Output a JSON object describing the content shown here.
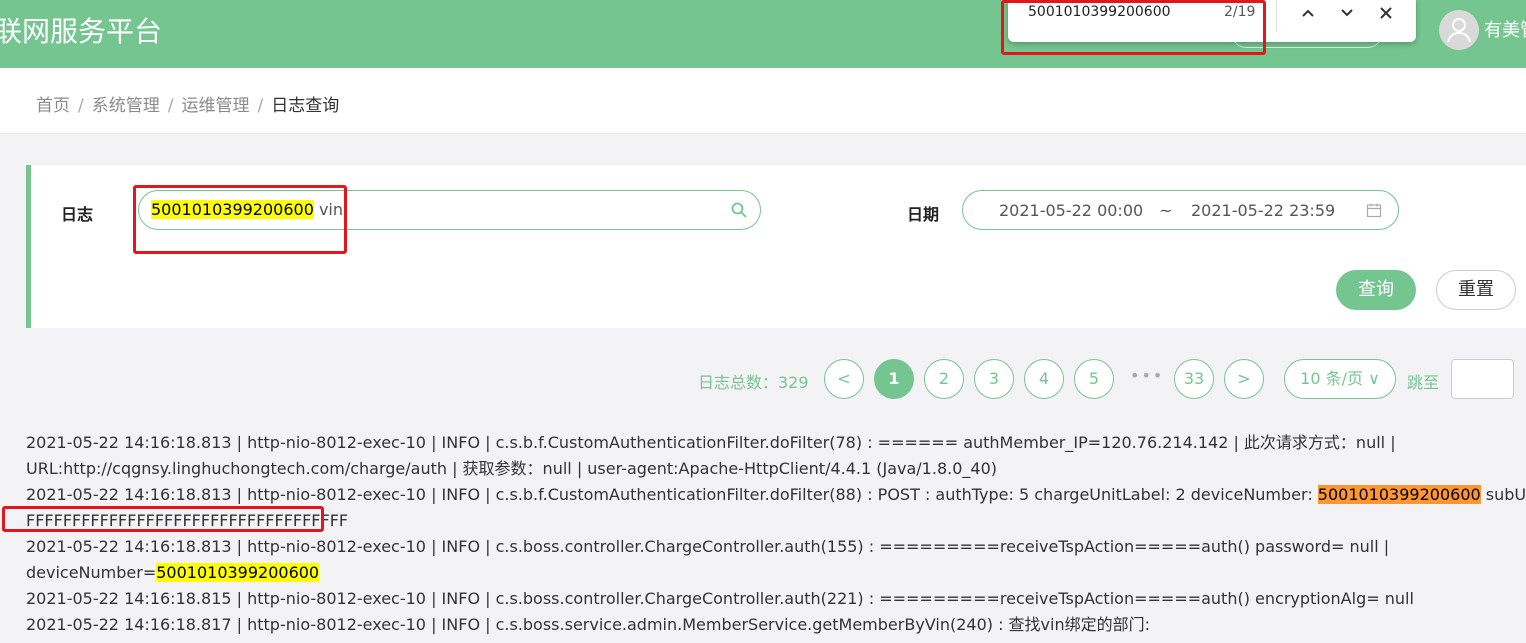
{
  "header": {
    "title": "联网服务平台",
    "user_name": "有美管",
    "avatar_icon": "user-avatar-icon"
  },
  "find_bar": {
    "query": "5001010399200600",
    "count": "2/19",
    "prev_icon": "chevron-up-icon",
    "next_icon": "chevron-down-icon",
    "close_icon": "close-icon"
  },
  "breadcrumb": {
    "items": [
      "首页",
      "系统管理",
      "运维管理"
    ],
    "current": "日志查询"
  },
  "filter": {
    "log_label": "日志",
    "log_value_highlight": "5001010399200600",
    "log_value_rest": " vin",
    "date_label": "日期",
    "date_start": "2021-05-22 00:00",
    "date_sep": "~",
    "date_end": "2021-05-22 23:59",
    "query_button": "查询",
    "reset_button": "重置"
  },
  "pagination": {
    "total": "日志总数：329",
    "prev": "<",
    "pages": [
      "1",
      "2",
      "3",
      "4",
      "5"
    ],
    "active_page": "1",
    "ellipsis": "•••",
    "last_page": "33",
    "next": ">",
    "page_size": "10 条/页",
    "jump_label": "跳至"
  },
  "logs": [
    {
      "pre": "2021-05-22 14:16:18.813 | http-nio-8012-exec-10 | INFO | c.s.b.f.CustomAuthenticationFilter.doFilter(78) : ====== authMember_IP=120.76.214.142 | 此次请求方式：null |",
      "hl": "",
      "post": ""
    },
    {
      "pre": "URL:http://cqgnsy.linghuchongtech.com/charge/auth | 获取参数：null | user-agent:Apache-HttpClient/4.4.1 (Java/1.8.0_40)",
      "hl": "",
      "post": ""
    },
    {
      "pre": "2021-05-22 14:16:18.813 | http-nio-8012-exec-10 | INFO | c.s.b.f.CustomAuthenticationFilter.doFilter(88) : POST : authType: 5 chargeUnitLabel: 2 deviceNumber: ",
      "hl": "5001010399200600",
      "post": " subUnits: vin:",
      "current": true
    },
    {
      "pre": "FFFFFFFFFFFFFFFFFFFFFFFFFFFFFFFFFFF",
      "hl": "",
      "post": ""
    },
    {
      "pre": "2021-05-22 14:16:18.813 | http-nio-8012-exec-10 | INFO | c.s.boss.controller.ChargeController.auth(155) : =========receiveTspAction=====auth() password= null |",
      "hl": "",
      "post": ""
    },
    {
      "pre": "deviceNumber=",
      "hl": "5001010399200600",
      "post": ""
    },
    {
      "pre": "2021-05-22 14:16:18.815 | http-nio-8012-exec-10 | INFO | c.s.boss.controller.ChargeController.auth(221) : =========receiveTspAction=====auth() encryptionAlg= null",
      "hl": "",
      "post": ""
    },
    {
      "pre": "2021-05-22 14:16:18.817 | http-nio-8012-exec-10 | INFO | c.s.boss.service.admin.MemberService.getMemberByVin(240) : 查找vin绑定的部门:",
      "hl": "",
      "post": ""
    }
  ],
  "colors": {
    "brand_green": "#75c590",
    "highlight": "#ffff00",
    "highlight_current": "#ff9632",
    "annotation_red": "#e2161b"
  }
}
